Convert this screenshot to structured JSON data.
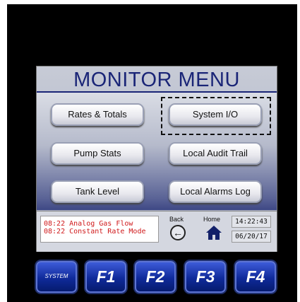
{
  "screen": {
    "title": "MONITOR MENU",
    "buttons": [
      {
        "label": "Rates & Totals"
      },
      {
        "label": "System I/O",
        "selected": true
      },
      {
        "label": "Pump Stats"
      },
      {
        "label": "Local Audit Trail"
      },
      {
        "label": "Tank Level"
      },
      {
        "label": "Local Alarms Log"
      }
    ]
  },
  "status": {
    "alarms": [
      "08:22 Analog Gas Flow",
      "08:22 Constant Rate Mode"
    ],
    "alarm_color": "#d0191b",
    "back_label": "Back",
    "home_label": "Home",
    "time": "14:22:43",
    "date": "06/20/17"
  },
  "keys": {
    "system": "SYSTEM",
    "f1": "F1",
    "f2": "F2",
    "f3": "F3",
    "f4": "F4"
  },
  "colors": {
    "title": "#1a2577",
    "key_blue": "#0f2a9a"
  }
}
